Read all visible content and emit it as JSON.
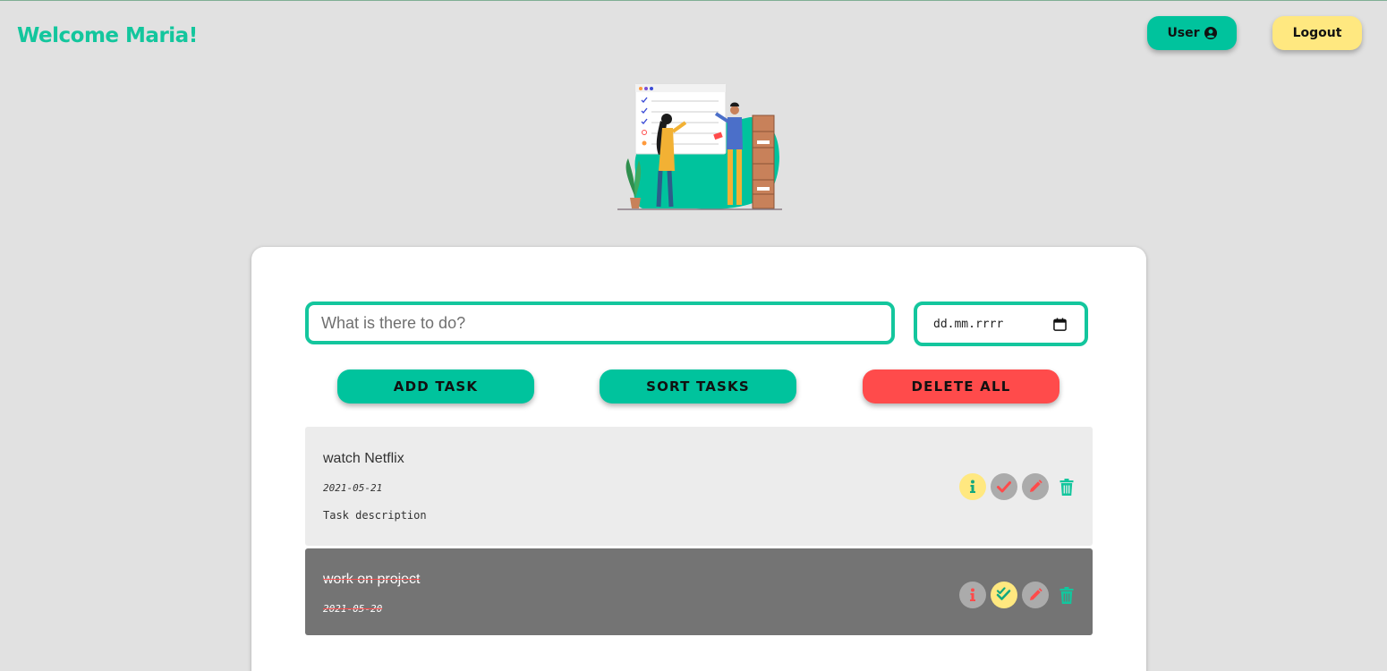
{
  "header": {
    "welcome": "Welcome Maria!",
    "user_label": "User",
    "logout_label": "Logout"
  },
  "form": {
    "task_placeholder": "What is there to do?",
    "date_placeholder": "dd.mm.rrrr",
    "add_label": "ADD TASK",
    "sort_label": "SORT TASKS",
    "delete_all_label": "DELETE ALL"
  },
  "tasks": [
    {
      "title": "watch Netflix",
      "date": "2021-05-21",
      "description": "Task description",
      "done": false
    },
    {
      "title": "work on project",
      "date": "2021-05-20",
      "description": "",
      "done": true
    }
  ],
  "colors": {
    "accent": "#13c69d",
    "button_green": "#00c39d",
    "button_red": "#ff4b4b",
    "button_yellow": "#ffe880",
    "background": "#e1e1e1",
    "done_task_bg": "#747474"
  },
  "icons": [
    "user-circle-icon",
    "calendar-icon",
    "info-icon",
    "check-icon",
    "double-check-icon",
    "pencil-icon",
    "trash-icon"
  ]
}
